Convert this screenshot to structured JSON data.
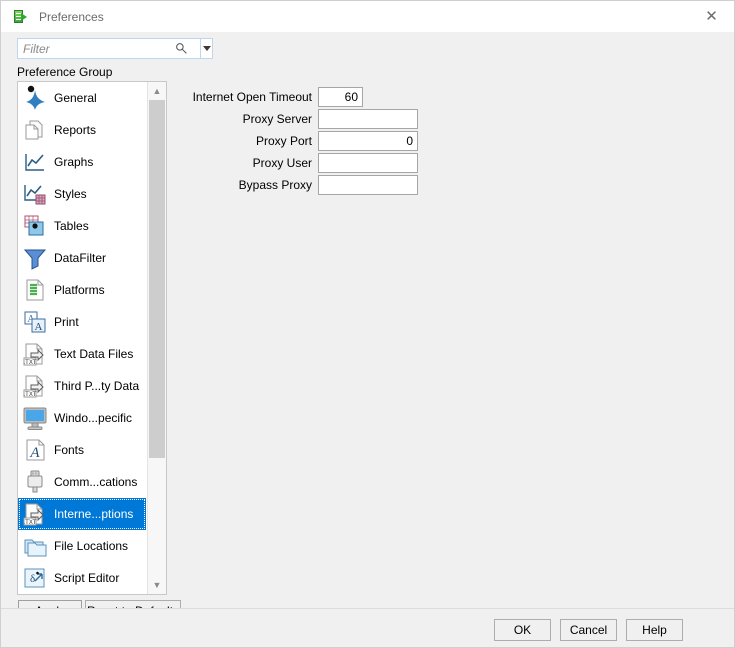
{
  "window": {
    "title": "Preferences",
    "title_icon": "green-document-arrow-icon",
    "close_icon": "close-icon"
  },
  "search": {
    "placeholder": "Filter",
    "value": "",
    "search_icon": "search-icon",
    "dropdown_icon": "chevron-down-icon"
  },
  "sidebar": {
    "label": "Preference Group",
    "selected_index": 13,
    "items": [
      {
        "label": "General",
        "icon": "star-burst-icon"
      },
      {
        "label": "Reports",
        "icon": "documents-icon"
      },
      {
        "label": "Graphs",
        "icon": "line-chart-icon"
      },
      {
        "label": "Styles",
        "icon": "chart-grid-icon"
      },
      {
        "label": "Tables",
        "icon": "table-grid-icon"
      },
      {
        "label": "DataFilter",
        "icon": "funnel-icon"
      },
      {
        "label": "Platforms",
        "icon": "document-list-icon"
      },
      {
        "label": "Print",
        "icon": "print-letter-icon"
      },
      {
        "label": "Text Data Files",
        "icon": "txt-file-arrow-icon"
      },
      {
        "label": "Third P...ty Data",
        "icon": "txt-file-arrow-icon"
      },
      {
        "label": "Windo...pecific",
        "icon": "monitor-icon"
      },
      {
        "label": "Fonts",
        "icon": "font-a-icon"
      },
      {
        "label": "Comm...cations",
        "icon": "plug-icon"
      },
      {
        "label": "Interne...ptions",
        "icon": "txt-file-arrow-icon"
      },
      {
        "label": "File Locations",
        "icon": "folders-icon"
      },
      {
        "label": "Script Editor",
        "icon": "script-icon"
      }
    ],
    "scroll_up_icon": "chevron-up-icon",
    "scroll_down_icon": "chevron-down-icon"
  },
  "left_buttons": {
    "apply": "Apply",
    "reset": "Reset to Defaults"
  },
  "form": {
    "fields": [
      {
        "label": "Internet Open Timeout",
        "value": "60"
      },
      {
        "label": "Proxy Server",
        "value": ""
      },
      {
        "label": "Proxy Port",
        "value": "0"
      },
      {
        "label": "Proxy User",
        "value": ""
      },
      {
        "label": "Bypass Proxy",
        "value": ""
      }
    ]
  },
  "footer": {
    "ok": "OK",
    "cancel": "Cancel",
    "help": "Help"
  },
  "colors": {
    "selection": "#0078d7",
    "dialog_bg": "#f0f0f0",
    "field_border": "#a6a6a6",
    "filter_border": "#bdd7ee"
  }
}
